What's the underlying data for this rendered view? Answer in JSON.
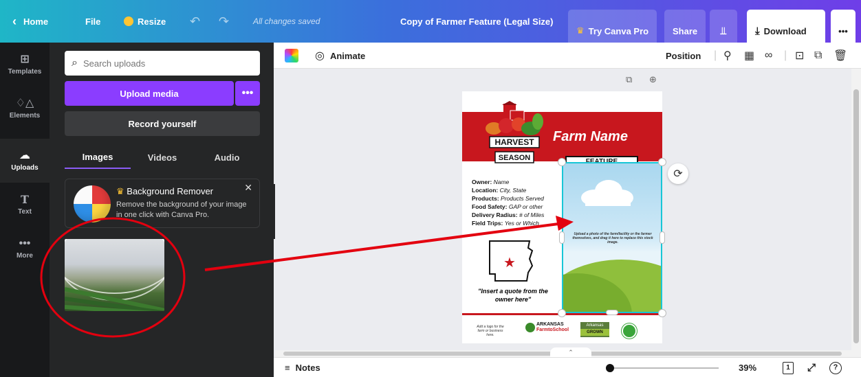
{
  "topbar": {
    "home": "Home",
    "file": "File",
    "resize": "Resize",
    "status": "All changes saved",
    "doc_title": "Copy of Farmer Feature (Legal Size)",
    "try_pro": "Try Canva Pro",
    "share": "Share",
    "download": "Download",
    "more": "•••"
  },
  "rail": {
    "items": [
      {
        "label": "Templates",
        "icon": "templates-icon"
      },
      {
        "label": "Elements",
        "icon": "elements-icon"
      },
      {
        "label": "Uploads",
        "icon": "uploads-icon"
      },
      {
        "label": "Text",
        "icon": "text-icon"
      },
      {
        "label": "More",
        "icon": "more-icon"
      }
    ]
  },
  "panel": {
    "search_placeholder": "Search uploads",
    "upload_media": "Upload media",
    "upload_more": "•••",
    "record": "Record yourself",
    "tabs": [
      "Images",
      "Videos",
      "Audio"
    ],
    "promo": {
      "title": "Background Remover",
      "desc": "Remove the background of your image in one click with Canva Pro."
    }
  },
  "toolbar": {
    "animate": "Animate",
    "position": "Position"
  },
  "design": {
    "farm_name": "Farm Name",
    "feature": "FEATURE",
    "logo_line1": "HARVEST",
    "logo_line2": "SEASON",
    "info": [
      {
        "label": "Owner:",
        "value": "Name"
      },
      {
        "label": "Location:",
        "value": "City, State"
      },
      {
        "label": "Products:",
        "value": "Products Served"
      },
      {
        "label": "Food Safety:",
        "value": "GAP or other"
      },
      {
        "label": "Delivery Radius:",
        "value": "# of Miles"
      },
      {
        "label": "Field Trips:",
        "value": "Yes or Which"
      }
    ],
    "quote": "\"Insert a quote from the owner here\"",
    "logo_hint": "Add a logo for the farm or business here.",
    "farm_to_school_1": "ARKANSAS",
    "farm_to_school_2": "FarmtoSchool",
    "ark_grown_1": "Arkansas",
    "ark_grown_2": "GROWN",
    "feature_image_text": "Upload a photo of the farm/facility or the farmer themselves, and drag it here to replace this stock image."
  },
  "bottombar": {
    "notes": "Notes",
    "zoom": "39%",
    "page_count": "1",
    "help": "?"
  },
  "colors": {
    "accent": "#8b3dff",
    "brand_red": "#c8171e",
    "selection": "#18c6d6",
    "annotation": "#e3000f"
  }
}
